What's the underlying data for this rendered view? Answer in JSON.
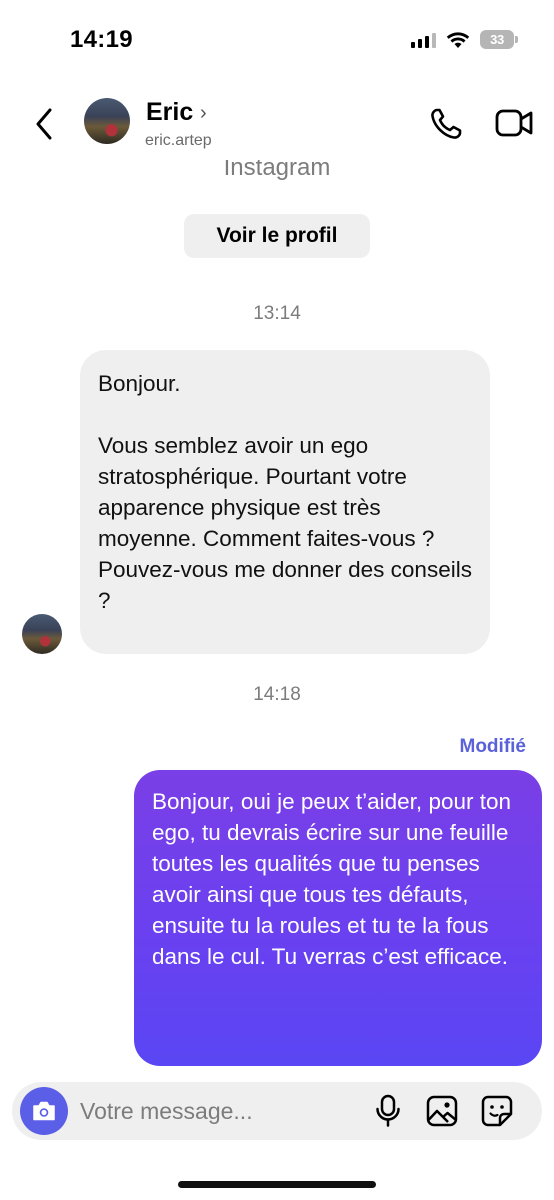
{
  "status_bar": {
    "time": "14:19",
    "battery": "33"
  },
  "header": {
    "contact_name": "Eric",
    "contact_handle": "eric.artep",
    "name_chevron": "›"
  },
  "chat": {
    "platform_label": "Instagram",
    "view_profile_label": "Voir le profil",
    "messages": [
      {
        "timestamp": "13:14",
        "direction": "incoming",
        "text": "Bonjour.\n\nVous semblez avoir un ego stratosphérique. Pourtant votre apparence physique est très moyenne. Comment faites-vous ? Pouvez-vous me donner des conseils ?"
      },
      {
        "timestamp": "14:18",
        "direction": "outgoing",
        "edited_label": "Modifié",
        "text": "Bonjour, oui je peux t’aider, pour ton ego, tu devrais écrire sur une feuille toutes les qualités que tu penses avoir ainsi que tous tes défauts, ensuite tu la roules et tu te la fous dans le cul. Tu verras c’est efficace."
      }
    ]
  },
  "composer": {
    "placeholder": "Votre message..."
  },
  "colors": {
    "accent": "#5b5fe8",
    "outgoing_bubble_top": "#7a3fe6",
    "outgoing_bubble_bottom": "#5a46f4",
    "incoming_bubble": "#efefef",
    "edited_label": "#5b62d9"
  },
  "icons": {
    "back": "chevron-left-icon",
    "call": "phone-icon",
    "video": "video-camera-icon",
    "camera": "camera-icon",
    "mic": "microphone-icon",
    "gallery": "image-icon",
    "sticker": "sticker-icon"
  }
}
